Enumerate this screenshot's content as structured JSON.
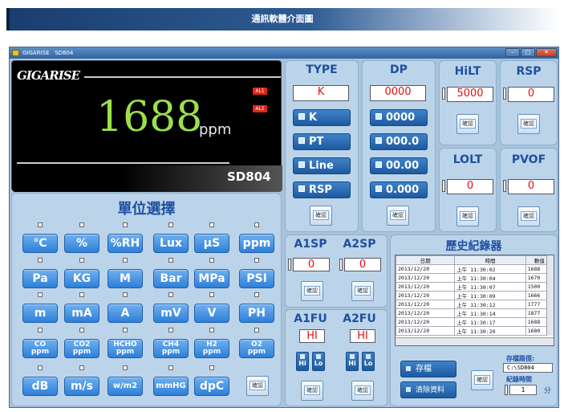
{
  "banner": {
    "title": "通訊軟體介面圖"
  },
  "window": {
    "brand": "GIGARISE",
    "model": "SD804",
    "btn_min": "–",
    "btn_max": "□",
    "btn_close": "✕"
  },
  "display": {
    "logo": "GIGARISE",
    "alarm1": "AL1",
    "alarm2": "AL2",
    "reading": "1688",
    "unit": "ppm",
    "model": "SD804"
  },
  "units": {
    "title": "單位選擇",
    "confirm": "確認",
    "row1": [
      "℃",
      "%",
      "%RH",
      "Lux",
      "μS",
      "ppm"
    ],
    "row2": [
      "Pa",
      "KG",
      "M",
      "Bar",
      "MPa",
      "PSI"
    ],
    "row3": [
      "m",
      "mA",
      "A",
      "mV",
      "V",
      "PH"
    ],
    "row4": [
      {
        "a": "CO",
        "b": "ppm"
      },
      {
        "a": "CO2",
        "b": "ppm"
      },
      {
        "a": "HCHO",
        "b": "ppm"
      },
      {
        "a": "CH4",
        "b": "ppm"
      },
      {
        "a": "H2",
        "b": "ppm"
      },
      {
        "a": "O2",
        "b": "ppm"
      }
    ],
    "row5": [
      "dB",
      "m/s",
      "w/m2",
      "mmHG",
      "dpC"
    ]
  },
  "type": {
    "title": "TYPE",
    "value": "K",
    "options": [
      "K",
      "PT",
      "Line",
      "RSP"
    ],
    "confirm": "確認"
  },
  "dp": {
    "title": "DP",
    "value": "0000",
    "options": [
      "0000",
      "000.0",
      "00.00",
      "0.000"
    ],
    "confirm": "確認"
  },
  "hilt": {
    "title": "HiLT",
    "value": "5000",
    "confirm": "確認"
  },
  "rsp": {
    "title": "RSP",
    "value": "0",
    "confirm": "確認"
  },
  "lolt": {
    "title": "LOLT",
    "value": "0",
    "confirm": "確認"
  },
  "pvof": {
    "title": "PVOF",
    "value": "0",
    "confirm": "確認"
  },
  "a1sp": {
    "title": "A1SP",
    "value": "0"
  },
  "a2sp": {
    "title": "A2SP",
    "value": "0"
  },
  "alarmsp": {
    "confirm1": "確認",
    "confirm2": "確認"
  },
  "a1fu": {
    "title": "A1FU",
    "value": "HI",
    "hi": "Hi",
    "lo": "Lo",
    "confirm": "確認"
  },
  "a2fu": {
    "title": "A2FU",
    "value": "HI",
    "hi": "Hi",
    "lo": "Lo",
    "confirm": "確認"
  },
  "history": {
    "title": "歷史紀錄器",
    "headers": [
      "日期",
      "時間",
      "數值"
    ],
    "rows": [
      [
        "2013/12/20",
        "上午 11:30:02",
        "1688"
      ],
      [
        "2013/12/20",
        "上午 11:30:04",
        "1670"
      ],
      [
        "2013/12/20",
        "上午 11:30:07",
        "1500"
      ],
      [
        "2013/12/20",
        "上午 11:30:09",
        "1666"
      ],
      [
        "2013/12/20",
        "上午 11:30:12",
        "1777"
      ],
      [
        "2013/12/20",
        "上午 11:30:14",
        "1877"
      ],
      [
        "2013/12/20",
        "上午 11:30:17",
        "1688"
      ],
      [
        "2013/12/20",
        "上午 11:30:20",
        "1680"
      ]
    ],
    "save": "存檔",
    "clear": "清除資料",
    "confirm": "確認",
    "path_label": "存檔路徑:",
    "path_value": "C:\\SD804",
    "interval_label": "紀錄時間",
    "interval_value": "1",
    "interval_unit": "分"
  }
}
